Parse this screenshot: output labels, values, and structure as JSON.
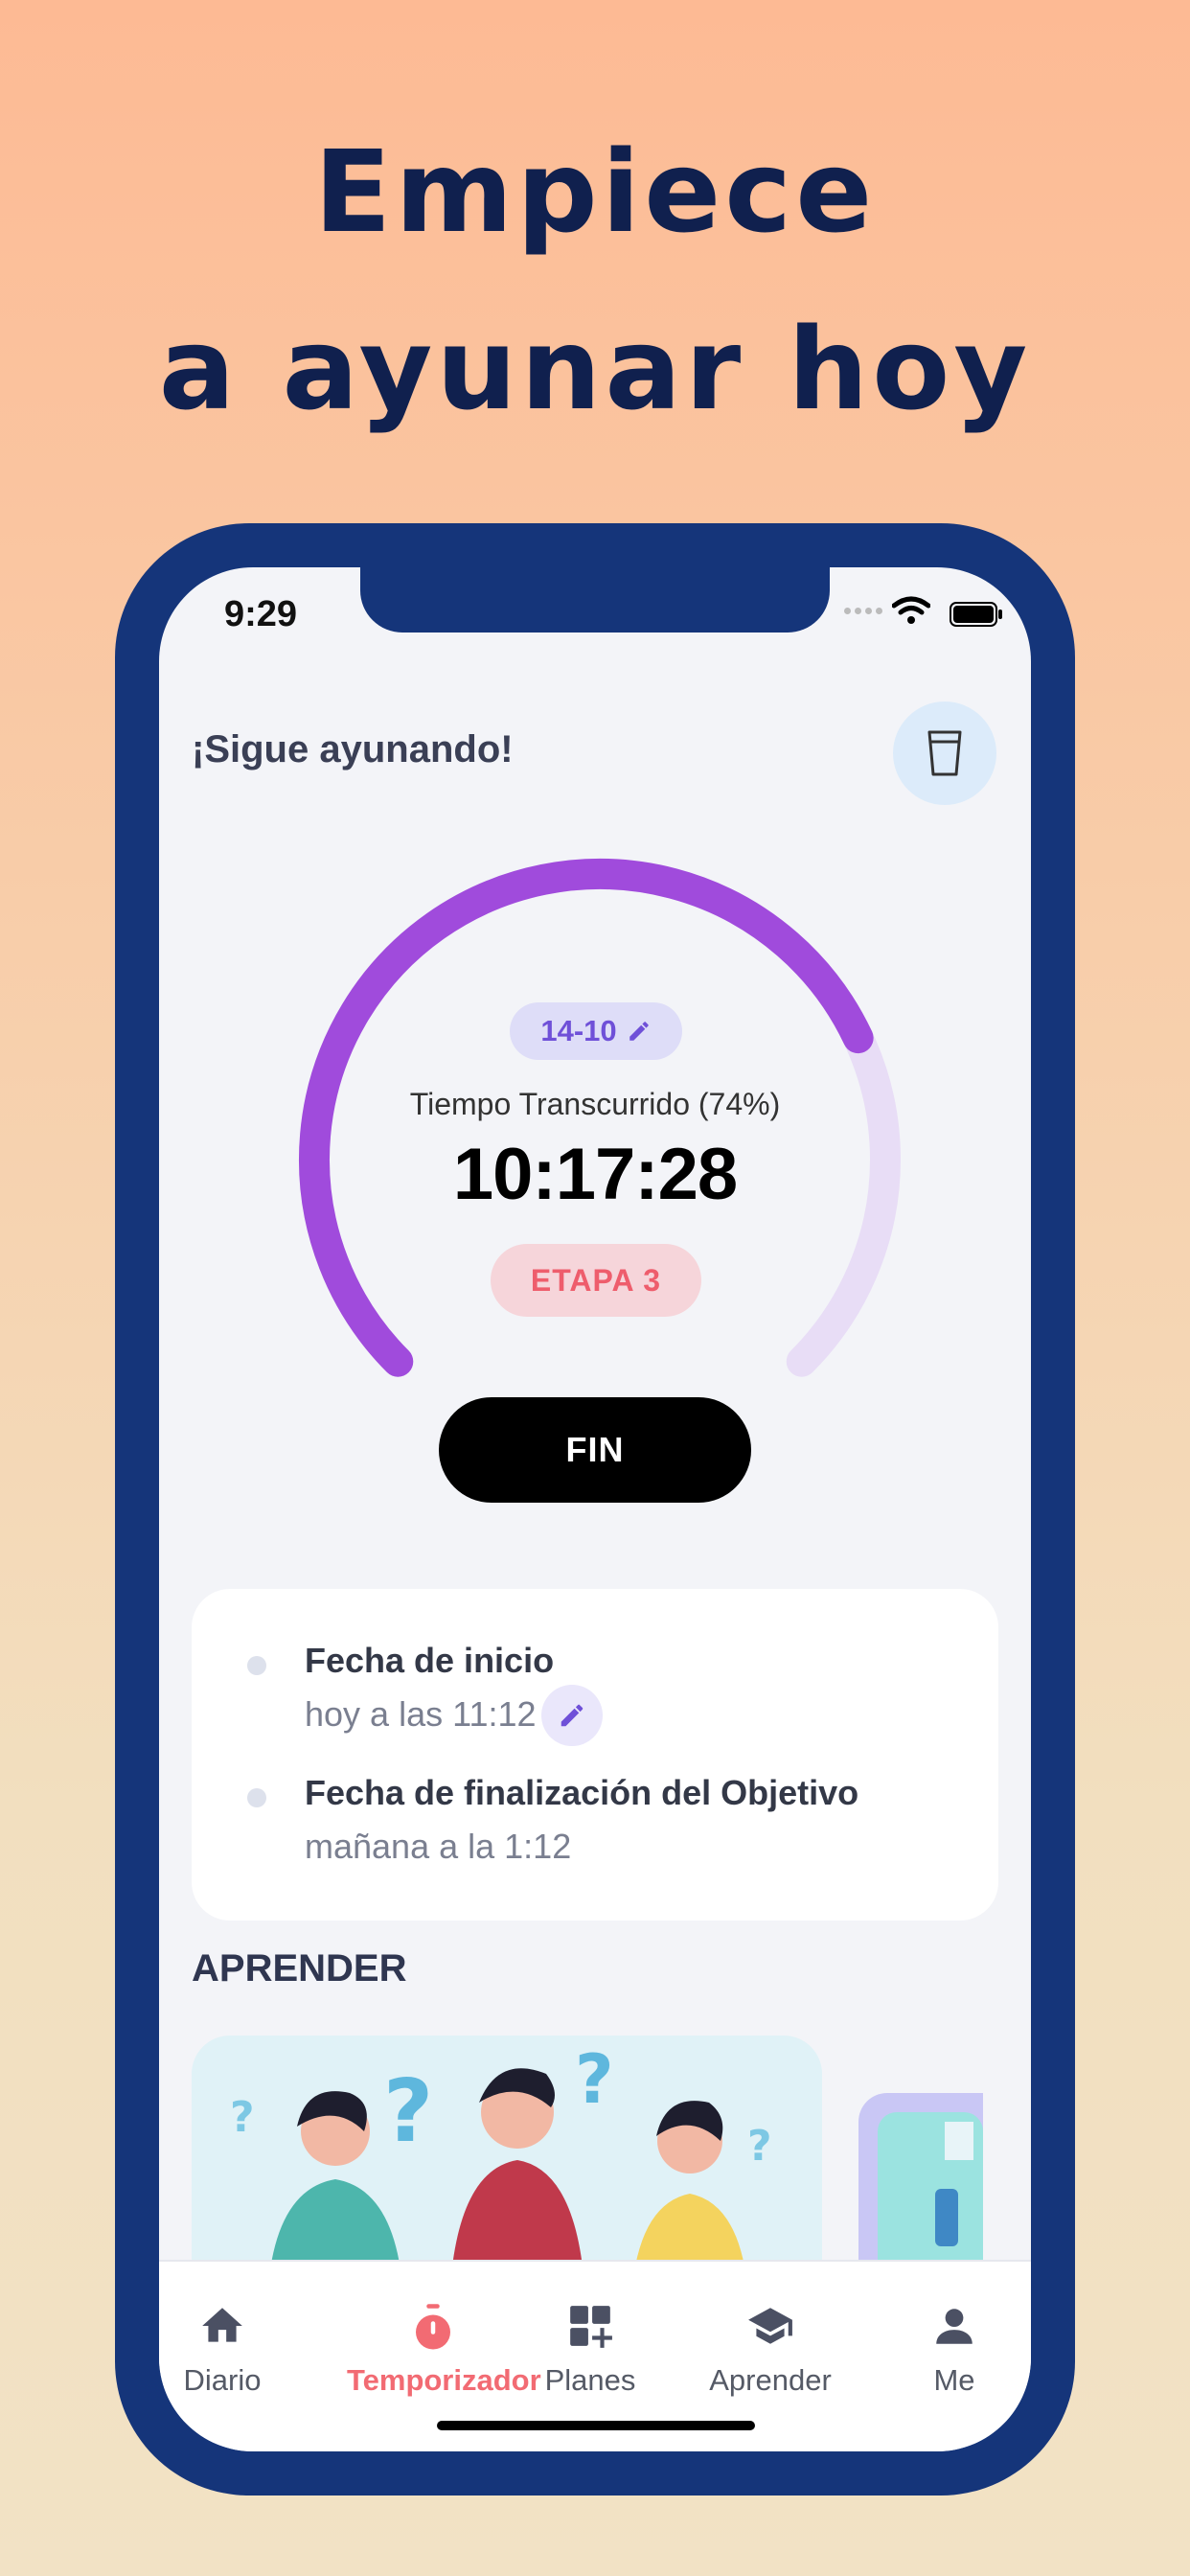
{
  "headline": {
    "line1": "Empiece",
    "line2": "a ayunar hoy"
  },
  "status_bar": {
    "time": "9:29"
  },
  "header": {
    "greeting": "¡Sigue ayunando!",
    "water_icon": "glass-icon"
  },
  "timer": {
    "plan": "14-10",
    "elapsed_label": "Tiempo Transcurrido (74%)",
    "progress": 0.74,
    "time": "10:17:28",
    "stage": "ETAPA 3",
    "end_button": "FIN",
    "colors": {
      "progress": "#A04BDC",
      "track": "#E8DDF6",
      "stage_text": "#EE5D6C",
      "plan_text": "#6F50D8"
    }
  },
  "fast_info": {
    "start_title": "Fecha de inicio",
    "start_value": "hoy a las 11:12",
    "goal_title": "Fecha de finalización del Objetivo",
    "goal_value": "mañana a la 1:12"
  },
  "learn": {
    "title": "APRENDER"
  },
  "tabs": [
    {
      "label": "Diario",
      "icon": "home-icon",
      "active": false
    },
    {
      "label": "Temporizador",
      "icon": "stopwatch-icon",
      "active": true
    },
    {
      "label": "Planes",
      "icon": "grid-plus-icon",
      "active": false
    },
    {
      "label": "Aprender",
      "icon": "graduation-cap-icon",
      "active": false
    },
    {
      "label": "Me",
      "icon": "person-icon",
      "active": false
    }
  ]
}
